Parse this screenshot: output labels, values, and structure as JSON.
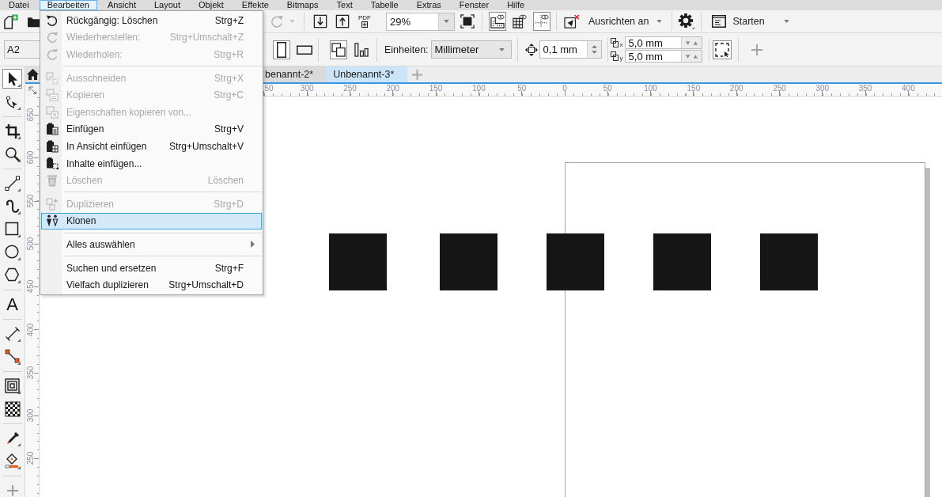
{
  "menu_bar": [
    {
      "label": "Datei",
      "selected": false
    },
    {
      "label": "Bearbeiten",
      "selected": true
    },
    {
      "label": "Ansicht",
      "selected": false
    },
    {
      "label": "Layout",
      "selected": false
    },
    {
      "label": "Objekt",
      "selected": false
    },
    {
      "label": "Effekte",
      "selected": false
    },
    {
      "label": "Bitmaps",
      "selected": false
    },
    {
      "label": "Text",
      "selected": false
    },
    {
      "label": "Tabelle",
      "selected": false
    },
    {
      "label": "Extras",
      "selected": false
    },
    {
      "label": "Fenster",
      "selected": false
    },
    {
      "label": "Hilfe",
      "selected": false
    }
  ],
  "standard_toolbar": {
    "redo_disabled": true,
    "pdf_label": "PDF",
    "zoom_level": "29%",
    "view_toggles": [
      {
        "kind": "rulers",
        "selected": true
      },
      {
        "kind": "grid",
        "selected": false
      },
      {
        "kind": "guides",
        "selected": true
      }
    ],
    "snap_label": "Ausrichten an",
    "launch_label": "Starten"
  },
  "property_bar": {
    "paper_size": "A2",
    "orientations": [
      {
        "kind": "portrait",
        "selected": true
      },
      {
        "kind": "landscape",
        "selected": false
      }
    ],
    "page_scope": [
      {
        "kind": "all",
        "selected": true
      },
      {
        "kind": "current",
        "selected": false
      }
    ],
    "units_label": "Einheiten:",
    "units": "Millimeter",
    "nudge_distance": "0,1 mm",
    "duplicate_offsets": [
      {
        "axis": "x",
        "value": "5,0 mm"
      },
      {
        "axis": "y",
        "value": "5,0 mm"
      }
    ],
    "frame_toggle": {
      "selected": true
    }
  },
  "document_tabs": [
    {
      "label": "benannt-2*",
      "selected": false
    },
    {
      "label": "Unbenannt-3*",
      "selected": true
    }
  ],
  "toolbox": [
    [
      {
        "kind": "pick",
        "selected": true
      },
      {
        "kind": "shape",
        "selected": false
      }
    ],
    [
      {
        "kind": "crop",
        "selected": false
      },
      {
        "kind": "zoom",
        "selected": false
      }
    ],
    [
      {
        "kind": "freehand",
        "selected": false
      },
      {
        "kind": "media",
        "selected": false
      },
      {
        "kind": "rectangle",
        "selected": false
      },
      {
        "kind": "ellipse",
        "selected": false
      },
      {
        "kind": "polygon",
        "selected": false
      }
    ],
    [
      {
        "kind": "text",
        "glyph": "A",
        "selected": false
      }
    ],
    [
      {
        "kind": "dimension",
        "selected": false
      },
      {
        "kind": "connector",
        "selected": false
      }
    ],
    [
      {
        "kind": "contour",
        "selected": false
      },
      {
        "kind": "transparency",
        "selected": false
      }
    ],
    [
      {
        "kind": "eyedropper",
        "selected": false
      },
      {
        "kind": "fill",
        "selected": false
      }
    ],
    [
      {
        "kind": "add",
        "selected": false
      }
    ]
  ],
  "rulers": {
    "horizontal": [
      "50",
      "300",
      "250",
      "200",
      "150",
      "100",
      "50",
      "0",
      "50",
      "100",
      "150",
      "200",
      "250",
      "300",
      "350",
      "400"
    ],
    "vertical": [
      "650",
      "600",
      "550",
      "500",
      "450",
      "400",
      "350",
      "300",
      "250"
    ]
  },
  "edit_menu": {
    "groups": [
      [
        {
          "label": "Rückgängig: Löschen",
          "shortcut": "Strg+Z",
          "disabled": false,
          "selected": false,
          "has_submenu": false
        },
        {
          "label": "Wiederherstellen:",
          "shortcut": "Strg+Umschalt+Z",
          "disabled": true,
          "selected": false,
          "has_submenu": false
        },
        {
          "label": "Wiederholen:",
          "shortcut": "Strg+R",
          "disabled": true,
          "selected": false,
          "has_submenu": false
        }
      ],
      [
        {
          "label": "Ausschneiden",
          "shortcut": "Strg+X",
          "disabled": true,
          "selected": false,
          "has_submenu": false
        },
        {
          "label": "Kopieren",
          "shortcut": "Strg+C",
          "disabled": true,
          "selected": false,
          "has_submenu": false
        },
        {
          "label": "Eigenschaften kopieren von...",
          "disabled": true,
          "selected": false,
          "has_submenu": false
        },
        {
          "label": "Einfügen",
          "shortcut": "Strg+V",
          "disabled": false,
          "selected": false,
          "has_submenu": false
        },
        {
          "label": "In Ansicht einfügen",
          "shortcut": "Strg+Umschalt+V",
          "disabled": false,
          "selected": false,
          "has_submenu": false
        },
        {
          "label": "Inhalte einfügen...",
          "disabled": false,
          "selected": false,
          "has_submenu": false
        },
        {
          "label": "Löschen",
          "shortcut": "Löschen",
          "disabled": true,
          "selected": false,
          "has_submenu": false
        }
      ],
      [
        {
          "label": "Duplizieren",
          "shortcut": "Strg+D",
          "disabled": true,
          "selected": false,
          "has_submenu": false
        },
        {
          "label": "Klonen",
          "disabled": false,
          "selected": true,
          "has_submenu": false
        }
      ],
      [
        {
          "label": "Alles auswählen",
          "disabled": false,
          "selected": false,
          "has_submenu": true
        }
      ],
      [
        {
          "label": "Suchen und ersetzen",
          "shortcut": "Strg+F",
          "disabled": false,
          "selected": false,
          "has_submenu": false
        },
        {
          "label": "Vielfach duplizieren",
          "shortcut": "Strg+Umschalt+D",
          "disabled": false,
          "selected": false,
          "has_submenu": false
        }
      ]
    ]
  }
}
